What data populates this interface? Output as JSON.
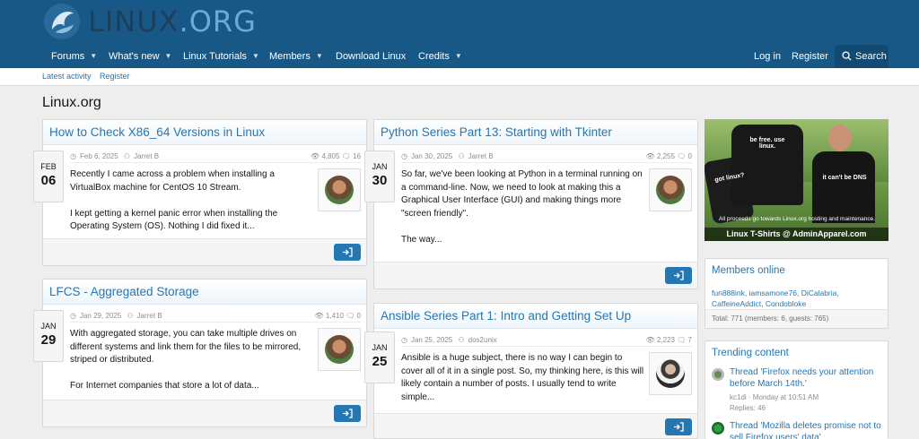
{
  "site": {
    "logo_part1": "LINUX",
    "logo_part2": ".ORG"
  },
  "nav": {
    "items": [
      {
        "label": "Forums",
        "has_menu": true
      },
      {
        "label": "What's new",
        "has_menu": true
      },
      {
        "label": "Linux Tutorials",
        "has_menu": true
      },
      {
        "label": "Members",
        "has_menu": true
      },
      {
        "label": "Download Linux",
        "has_menu": false
      },
      {
        "label": "Credits",
        "has_menu": true
      }
    ],
    "login": "Log in",
    "register": "Register",
    "search": "Search"
  },
  "subnav": {
    "latest": "Latest activity",
    "register": "Register"
  },
  "page_title": "Linux.org",
  "articles": [
    {
      "title": "How to Check X86_64 Versions in Linux",
      "date": "Feb 6, 2025",
      "author": "Jarret B",
      "views": "4,805",
      "replies": "16",
      "tab_month": "FEB",
      "tab_day": "06",
      "para1": "Recently I came across a problem when installing a VirtualBox machine for CentOS 10 Stream.",
      "para2": "I kept getting a kernel panic error when installing the Operating System (OS). Nothing I did fixed it..."
    },
    {
      "title": "Python Series Part 13: Starting with Tkinter",
      "date": "Jan 30, 2025",
      "author": "Jarret B",
      "views": "2,255",
      "replies": "0",
      "tab_month": "JAN",
      "tab_day": "30",
      "para1": "So far, we've been looking at Python in a terminal running on a command-line. Now, we need to look at making this a Graphical User Interface (GUI) and making things more \"screen friendly\".",
      "para2": "The way..."
    },
    {
      "title": "LFCS - Aggregated Storage",
      "date": "Jan 29, 2025",
      "author": "Jarret B",
      "views": "1,410",
      "replies": "0",
      "tab_month": "JAN",
      "tab_day": "29",
      "para1": "With aggregated storage, you can take multiple drives on different systems and link them for the files to be mirrored, striped or distributed.",
      "para2": "For Internet companies that store a lot of data..."
    },
    {
      "title": "Ansible Series Part 1: Intro and Getting Set Up",
      "date": "Jan 25, 2025",
      "author": "dos2unix",
      "views": "2,223",
      "replies": "7",
      "tab_month": "JAN",
      "tab_day": "25",
      "para1": "Ansible is a huge subject, there is no way I can begin to cover all of it in a single post. So, my thinking here, is this will likely contain a number of posts. I usually tend to write simple..."
    }
  ],
  "promo": {
    "shirt_text1": "be free. use linux.",
    "shirt_text2": "got linux?",
    "shirt_text3": "it can't be DNS",
    "note": "All proceeds go towards Linux.org hosting and maintenance.",
    "footer": "Linux T-Shirts @ AdminApparel.com"
  },
  "members_online": {
    "title": "Members online",
    "users": "fun888ink, iamsamone76, DiCalabria, CaffeineAddict, Condobloke",
    "total": "Total: 771 (members: 6, guests: 765)"
  },
  "trending": {
    "title": "Trending content",
    "items": [
      {
        "title": "Thread 'Firefox needs your attention before March 14th.'",
        "meta": "kc1di · Monday at 10:51 AM",
        "replies": "Replies: 46"
      },
      {
        "title": "Thread 'Mozilla deletes promise not to sell Firefox users' data'"
      }
    ]
  },
  "colors": {
    "header": "#185886",
    "link": "#2577b1",
    "button": "#2577b1"
  }
}
